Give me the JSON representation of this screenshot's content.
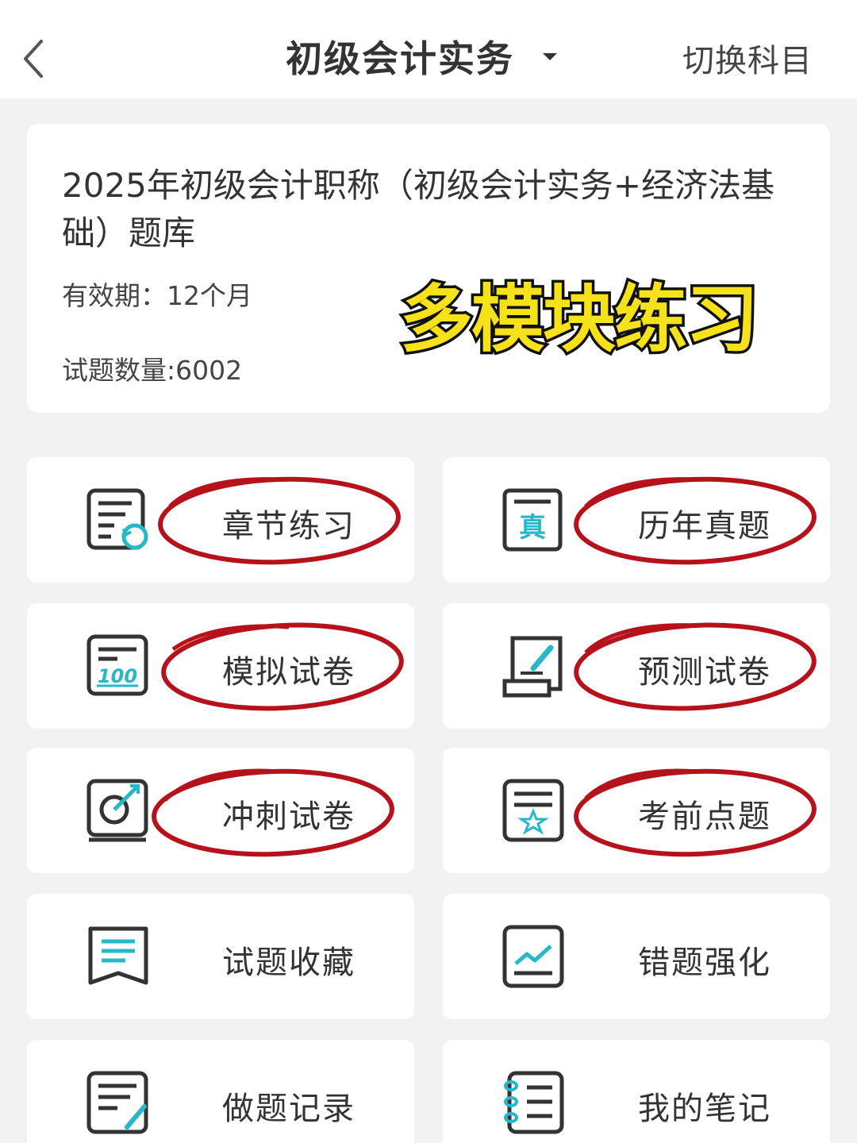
{
  "header": {
    "title": "初级会计实务",
    "switch_label": "切换科目"
  },
  "course": {
    "name": "2025年初级会计职称（初级会计实务+经济法基础）题库",
    "validity": "有效期：12个月",
    "count": "试题数量:6002",
    "promo_text": "多模块练习"
  },
  "modules": [
    {
      "label": "章节练习",
      "icon": "chapter-practice-icon",
      "circled": true
    },
    {
      "label": "历年真题",
      "icon": "past-exams-icon",
      "circled": true
    },
    {
      "label": "模拟试卷",
      "icon": "mock-exam-icon",
      "circled": true
    },
    {
      "label": "预测试卷",
      "icon": "forecast-exam-icon",
      "circled": true
    },
    {
      "label": "冲刺试卷",
      "icon": "sprint-exam-icon",
      "circled": true
    },
    {
      "label": "考前点题",
      "icon": "key-points-icon",
      "circled": true
    },
    {
      "label": "试题收藏",
      "icon": "favorites-icon",
      "circled": false
    },
    {
      "label": "错题强化",
      "icon": "wrong-questions-icon",
      "circled": false
    },
    {
      "label": "做题记录",
      "icon": "practice-record-icon",
      "circled": false
    },
    {
      "label": "我的笔记",
      "icon": "notes-icon",
      "circled": false
    }
  ],
  "colors": {
    "accent": "#26b8c8",
    "icon_stroke": "#333333",
    "annotation": "#b5121b",
    "promo_fill": "#f5e21a"
  }
}
